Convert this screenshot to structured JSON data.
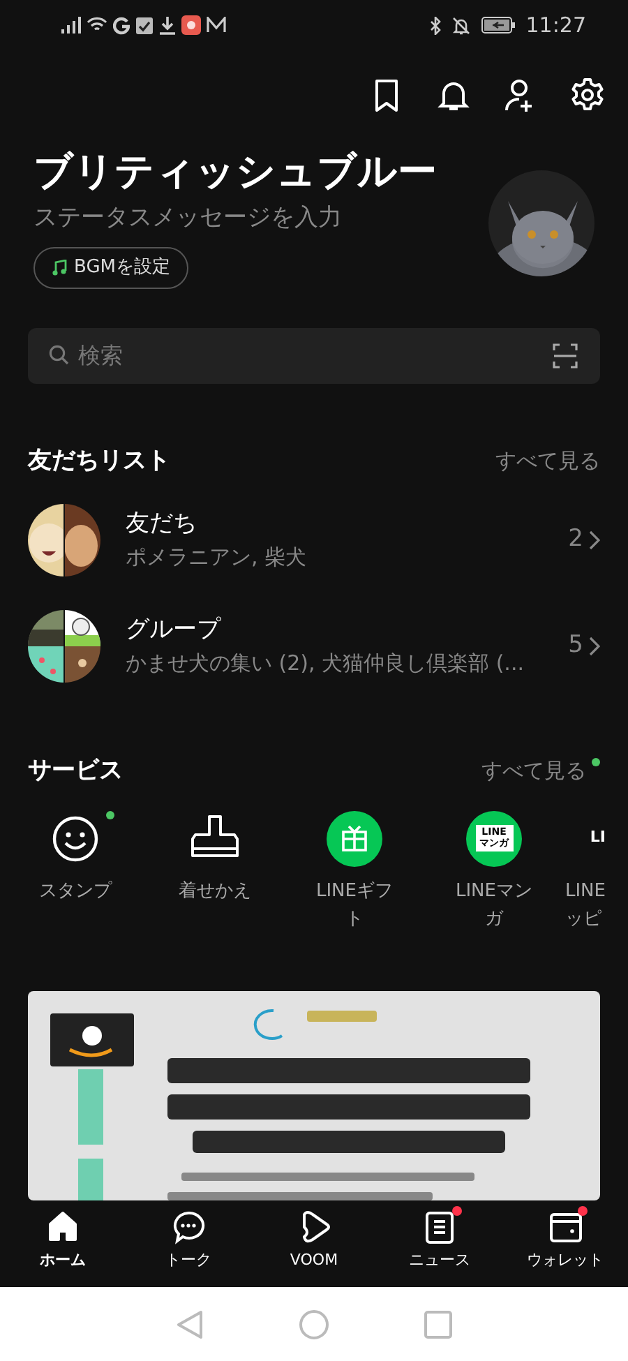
{
  "status_bar": {
    "time": "11:27"
  },
  "toolbar": {
    "icons": [
      {
        "kind": "bookmark"
      },
      {
        "kind": "bell"
      },
      {
        "kind": "add-friend"
      },
      {
        "kind": "settings"
      }
    ]
  },
  "profile": {
    "name": "ブリティッシュブルー",
    "status_placeholder": "ステータスメッセージを入力",
    "bgm_button": "BGMを設定"
  },
  "search": {
    "placeholder": "検索"
  },
  "friends_section": {
    "title": "友だちリスト",
    "see_all": "すべて見る",
    "see_all_new": false,
    "rows": [
      {
        "title": "友だち",
        "subtitle": "ポメラニアン, 柴犬",
        "count": "2"
      },
      {
        "title": "グループ",
        "subtitle": "かませ犬の集い (2), 犬猫仲良し倶楽部 (...",
        "count": "5"
      }
    ]
  },
  "services_section": {
    "title": "サービス",
    "see_all": "すべて見る",
    "see_all_new": true,
    "items": [
      {
        "kind": "stamp",
        "label_lines": [
          "スタンプ"
        ],
        "new": true
      },
      {
        "kind": "theme",
        "label_lines": [
          "着せかえ"
        ],
        "new": false
      },
      {
        "kind": "gift",
        "label_lines": [
          "LINEギフ",
          "ト"
        ],
        "new": false
      },
      {
        "kind": "manga",
        "label_lines": [
          "LINEマン",
          "ガ"
        ],
        "new": false,
        "logo_lines": [
          "LINE",
          "マンガ"
        ]
      },
      {
        "kind": "shopping",
        "label_lines": [
          "LINE",
          "ッピ"
        ],
        "new": false,
        "logo_lines": [
          "LI"
        ]
      }
    ]
  },
  "bottom_nav": [
    {
      "kind": "home",
      "label": "ホーム",
      "selected": true,
      "badge": false
    },
    {
      "kind": "talk",
      "label": "トーク",
      "selected": false,
      "badge": false
    },
    {
      "kind": "voom",
      "label": "VOOM",
      "selected": false,
      "badge": false
    },
    {
      "kind": "news",
      "label": "ニュース",
      "selected": false,
      "badge": true
    },
    {
      "kind": "wallet",
      "label": "ウォレット",
      "selected": false,
      "badge": true
    }
  ]
}
